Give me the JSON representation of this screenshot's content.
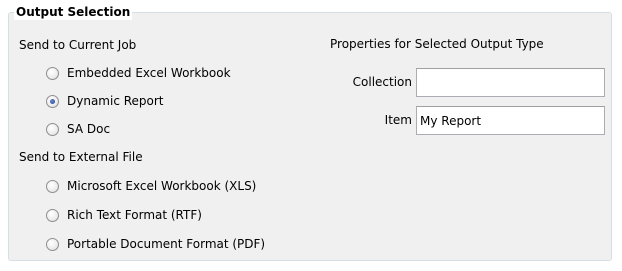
{
  "group": {
    "title": "Output Selection"
  },
  "send_current": {
    "label": "Send to Current Job",
    "options": [
      {
        "label": "Embedded Excel Workbook",
        "checked": false
      },
      {
        "label": "Dynamic Report",
        "checked": true
      },
      {
        "label": "SA Doc",
        "checked": false
      }
    ]
  },
  "send_external": {
    "label": "Send to External File",
    "options": [
      {
        "label": "Microsoft Excel Workbook (XLS)",
        "checked": false
      },
      {
        "label": "Rich Text Format (RTF)",
        "checked": false
      },
      {
        "label": "Portable Document Format (PDF)",
        "checked": false
      }
    ]
  },
  "properties": {
    "title": "Properties for Selected Output Type",
    "collection": {
      "label": "Collection",
      "value": ""
    },
    "item": {
      "label": "Item",
      "value": "My Report"
    }
  }
}
